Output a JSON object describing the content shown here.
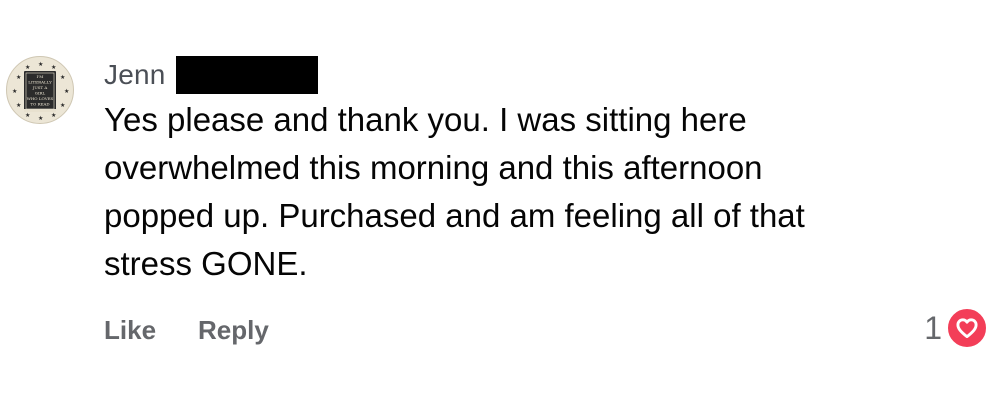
{
  "comment": {
    "author": "Jenn",
    "lines": [
      "Yes please and thank you. I was sitting here",
      "overwhelmed this morning and this afternoon",
      "popped up. Purchased and am feeling all of that",
      "stress GONE."
    ],
    "avatar_text": [
      "I'M",
      "LITERALLY",
      "JUST A",
      "GIRL",
      "WHO LOVES",
      "TO READ"
    ],
    "actions": {
      "like_label": "Like",
      "reply_label": "Reply"
    },
    "reactions": {
      "count": "1",
      "icon": "love-reaction-icon",
      "color": "#f33e58"
    }
  }
}
